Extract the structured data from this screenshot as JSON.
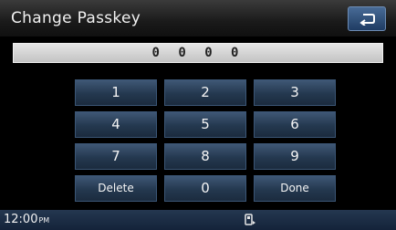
{
  "header": {
    "title": "Change Passkey",
    "back_icon": "return-arrow-icon"
  },
  "passkey": {
    "value": "0 0 0 0"
  },
  "keypad": {
    "keys": [
      "1",
      "2",
      "3",
      "4",
      "5",
      "6",
      "7",
      "8",
      "9",
      "Delete",
      "0",
      "Done"
    ]
  },
  "status": {
    "time": "12:00",
    "ampm": "PM",
    "icon": "bluetooth-phone-icon"
  },
  "colors": {
    "key_face": "#2a3f5a",
    "back_button": "#35557e",
    "field": "#d6d6d6",
    "status_bar": "#1c2d45"
  }
}
